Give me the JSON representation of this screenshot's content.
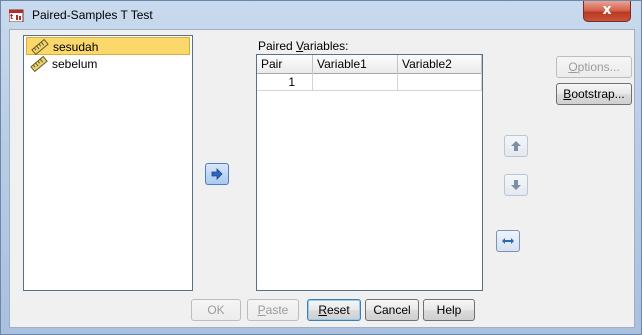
{
  "window": {
    "title": "Paired-Samples T Test",
    "close_label": "x"
  },
  "source_list": {
    "items": [
      {
        "label": "sesudah",
        "selected": true,
        "icon": "scale-ruler-icon"
      },
      {
        "label": "sebelum",
        "selected": false,
        "icon": "scale-ruler-icon"
      }
    ]
  },
  "paired": {
    "label_pre": "Paired ",
    "label_accel": "V",
    "label_post": "ariables:",
    "columns": [
      "Pair",
      "Variable1",
      "Variable2"
    ],
    "rows": [
      {
        "pair": "1",
        "variable1": "",
        "variable2": ""
      }
    ]
  },
  "side_buttons": {
    "options": {
      "pre": "",
      "accel": "O",
      "post": "ptions..."
    },
    "bootstrap": {
      "pre": "",
      "accel": "B",
      "post": "ootstrap..."
    }
  },
  "footer": {
    "ok": "OK",
    "paste": {
      "pre": "",
      "accel": "P",
      "post": "aste"
    },
    "reset": {
      "pre": "",
      "accel": "R",
      "post": "eset"
    },
    "cancel": "Cancel",
    "help": "Help"
  },
  "icons": {
    "move": "arrow-right-icon",
    "up": "arrow-up-icon",
    "down": "arrow-down-icon",
    "swap": "swap-horizontal-icon"
  },
  "colors": {
    "selection": "#fbd86c",
    "accent": "#4f7fbf"
  }
}
